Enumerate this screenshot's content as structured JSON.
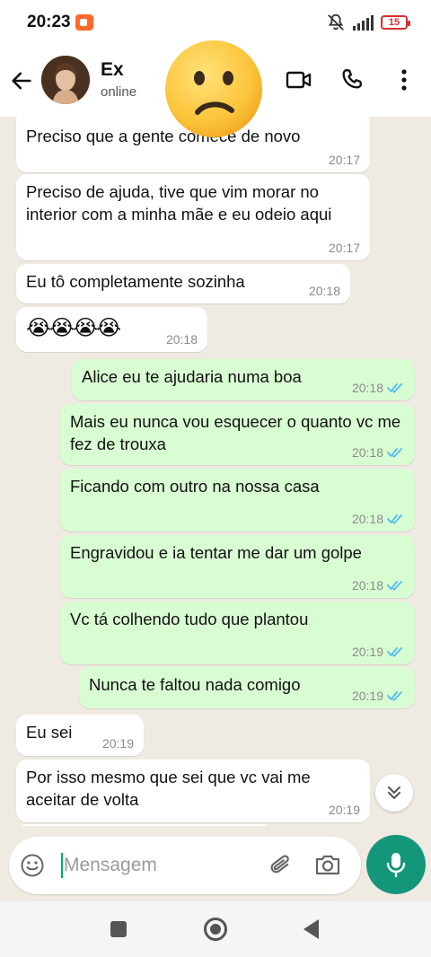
{
  "status_bar": {
    "time": "20:23",
    "battery": "15"
  },
  "header": {
    "contact_name": "Ex",
    "contact_status": "online"
  },
  "messages": [
    {
      "dir": "in",
      "text": "Preciso que a gente comece de novo",
      "time": "20:17"
    },
    {
      "dir": "in",
      "text": "Preciso de ajuda, tive que vim morar no interior com a minha mãe e eu odeio aqui",
      "time": "20:17"
    },
    {
      "dir": "in",
      "text": "Eu tô completamente sozinha",
      "time": "20:18"
    },
    {
      "dir": "in",
      "text": "😭😭😭😭",
      "time": "20:18"
    },
    {
      "dir": "out",
      "text": "Alice eu te ajudaria numa boa",
      "time": "20:18",
      "status": "read"
    },
    {
      "dir": "out",
      "text": "Mais eu nunca vou esquecer o quanto vc me fez de trouxa",
      "time": "20:18",
      "status": "read"
    },
    {
      "dir": "out",
      "text": "Ficando com outro na nossa casa",
      "time": "20:18",
      "status": "read"
    },
    {
      "dir": "out",
      "text": "Engravidou e ia tentar me dar um golpe",
      "time": "20:18",
      "status": "read"
    },
    {
      "dir": "out",
      "text": "Vc tá colhendo tudo que plantou",
      "time": "20:19",
      "status": "read"
    },
    {
      "dir": "out",
      "text": "Nunca te faltou nada comigo",
      "time": "20:19",
      "status": "read"
    },
    {
      "dir": "in",
      "text": "Eu sei",
      "time": "20:19"
    },
    {
      "dir": "in",
      "text": "Por isso mesmo que sei que vc vai me aceitar de volta",
      "time": "20:19"
    }
  ],
  "composer": {
    "placeholder": "Mensagem"
  },
  "colors": {
    "incoming": "#ffffff",
    "outgoing": "#d9fdd3",
    "accent": "#14967b",
    "read_ticks": "#53bdeb",
    "chat_bg": "#efeae2"
  },
  "icons": {
    "back": "arrow-left-icon",
    "video": "video-call-icon",
    "call": "phone-icon",
    "menu": "more-vert-icon",
    "sticker": "confused-face-emoji",
    "emoji": "emoji-icon",
    "attach": "paperclip-icon",
    "camera": "camera-icon",
    "mic": "mic-icon",
    "scroll": "double-chevron-down-icon"
  }
}
